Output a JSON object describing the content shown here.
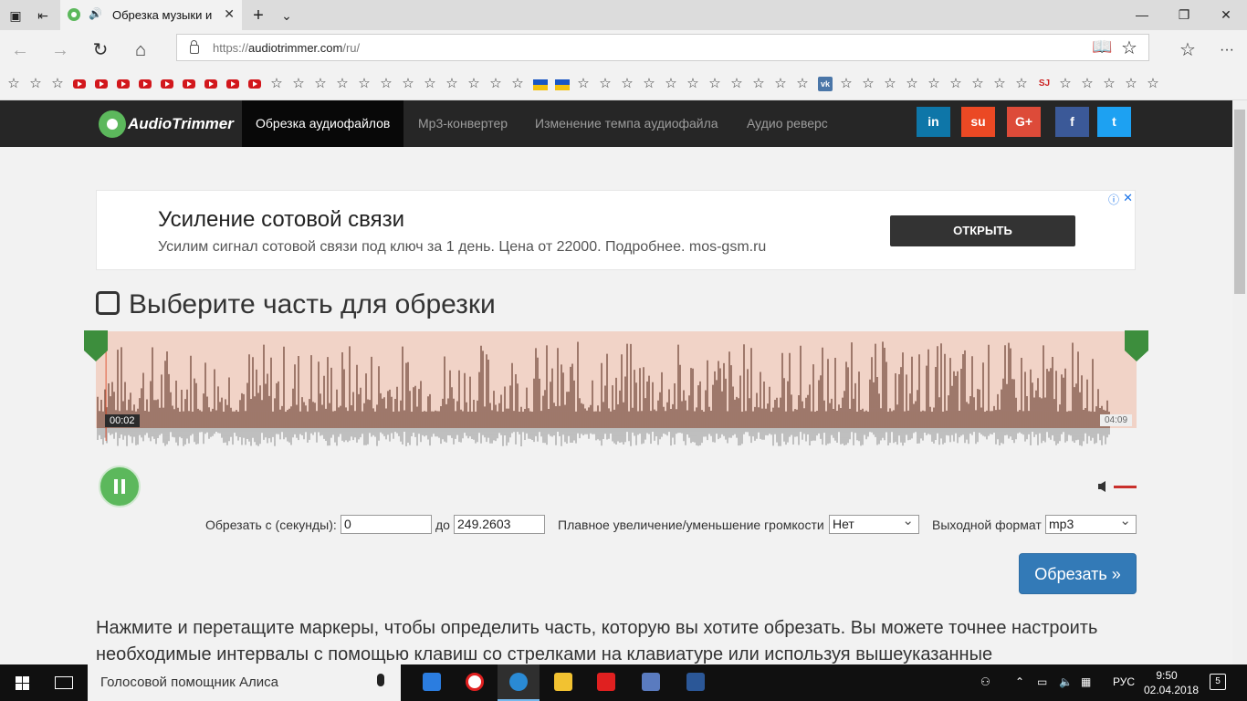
{
  "browser": {
    "tab_title": "Обрезка музыки и",
    "url_prefix": "https://",
    "url_domain": "audiotrimmer.com",
    "url_path": "/ru/"
  },
  "site": {
    "logo": "AudioTrimmer",
    "menu": [
      "Обрезка аудиофайлов",
      "Mp3-конвертер",
      "Изменение темпа аудиофайла",
      "Аудио реверс"
    ],
    "social": [
      {
        "label": "in",
        "color": "#0e76a8"
      },
      {
        "label": "su",
        "color": "#eb4924"
      },
      {
        "label": "G+",
        "color": "#dd4b39"
      },
      {
        "label": "f",
        "color": "#3b5998"
      },
      {
        "label": "t",
        "color": "#1da1f2"
      }
    ]
  },
  "ad": {
    "headline": "Усиление сотовой связи",
    "description": "Усилим сигнал сотовой связи под ключ за 1 день. Цена от 22000. Подробнее. mos-gsm.ru",
    "button": "ОТКРЫТЬ"
  },
  "editor": {
    "title": "Выберите часть для обрезки",
    "time_start": "00:02",
    "time_end": "04:09",
    "progress_fraction": 0.008,
    "trim_from_label": "Обрезать с (секунды):",
    "trim_from_value": "0",
    "trim_to_label": "до",
    "trim_to_value": "249.2603",
    "fade_label": "Плавное увеличение/уменьшение громкости",
    "fade_value": "Нет",
    "format_label": "Выходной формат",
    "format_value": "mp3",
    "trim_button": "Обрезать »",
    "accent_color": "#5cb85c",
    "waveform_color": "#7b5144",
    "selection_color": "#f1d3c7"
  },
  "help_text": "Нажмите и перетащите маркеры, чтобы определить часть, которую вы хотите обрезать. Вы можете точнее настроить необходимые интервалы с помощью клавиш со стрелками на клавиатуре или используя вышеуказанные",
  "taskbar": {
    "search_text": "Голосовой помощник Алиса",
    "language": "РУС",
    "time": "9:50",
    "date": "02.04.2018",
    "notifications": "5"
  }
}
